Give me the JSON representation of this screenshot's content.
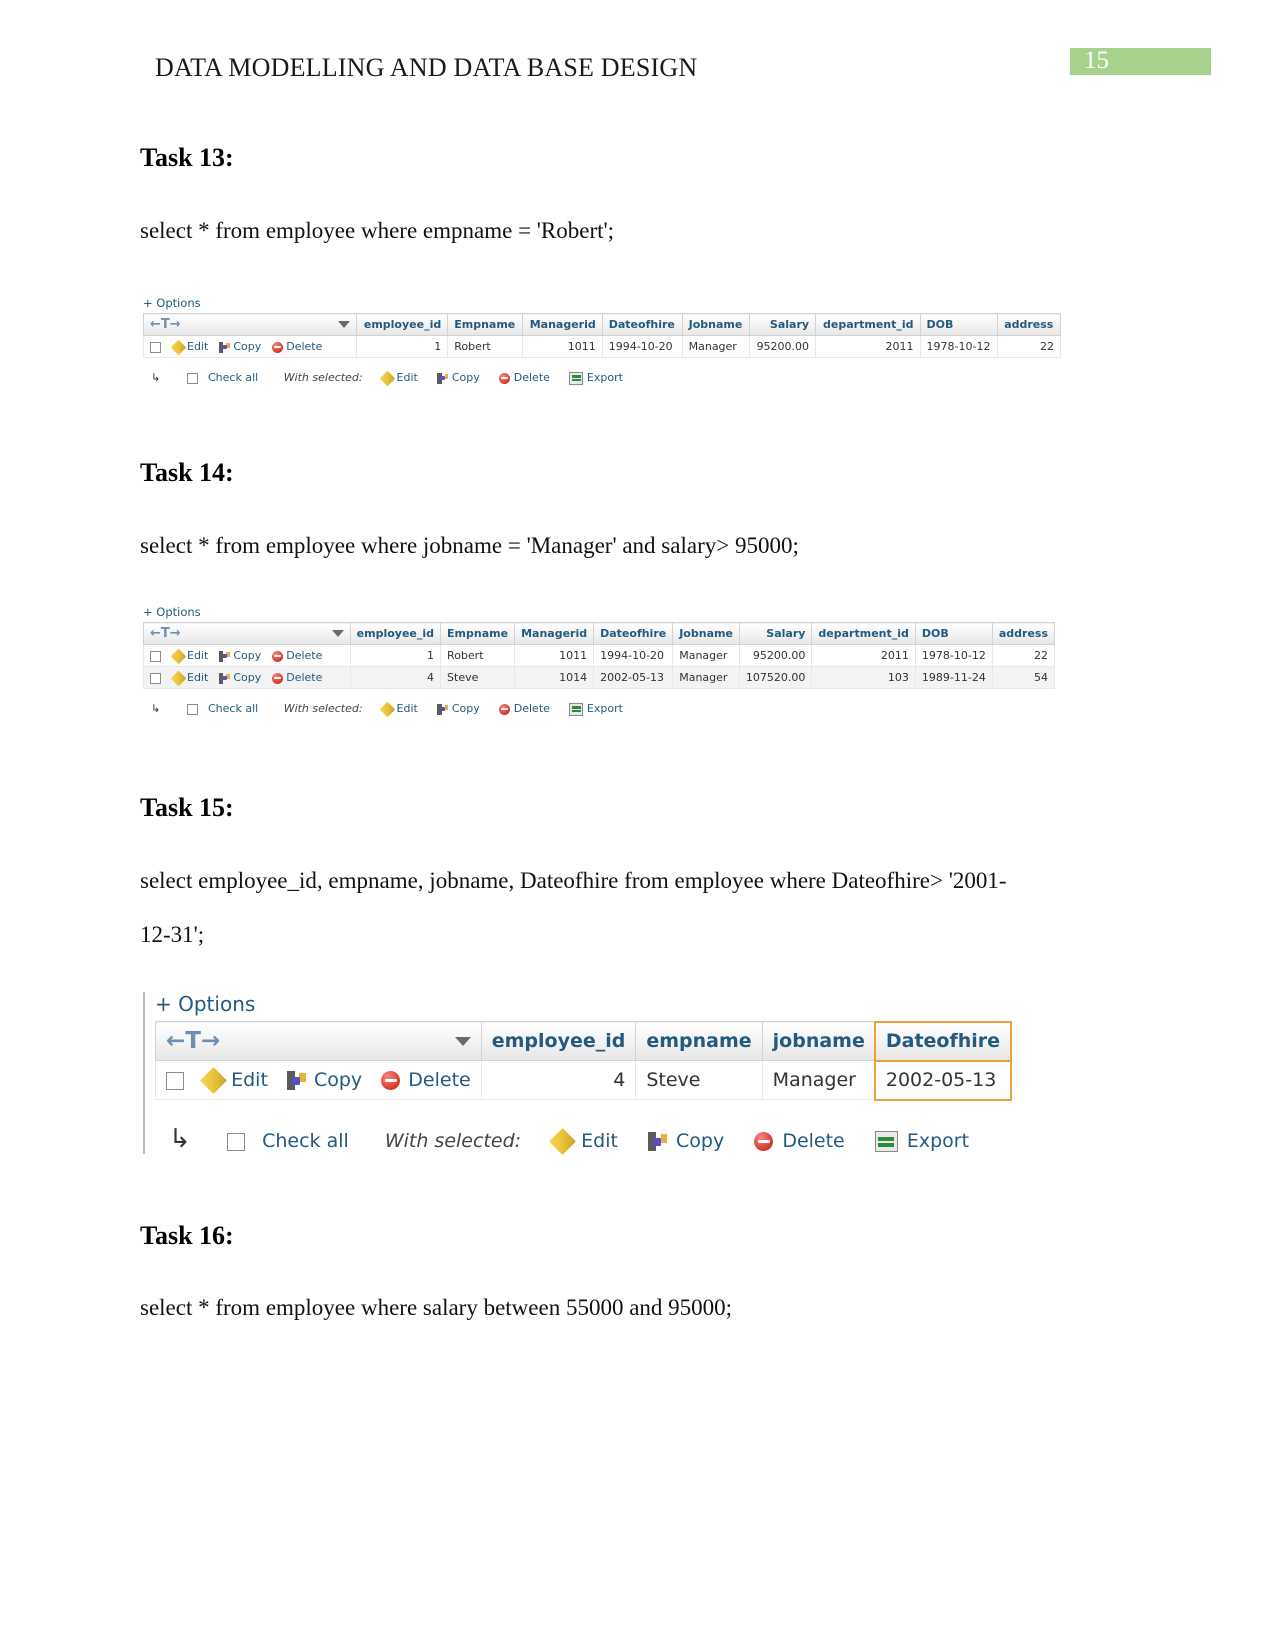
{
  "header": {
    "title": "DATA MODELLING AND DATA BASE DESIGN",
    "page_number": "15",
    "badge_color": "#a9d18e"
  },
  "tasks": [
    {
      "heading": "Task 13:",
      "query": "select * from employee where empname = 'Robert';"
    },
    {
      "heading": "Task 14:",
      "query": "select * from employee where jobname = 'Manager' and salary> 95000;"
    },
    {
      "heading": "Task 15:",
      "query_line1": "select employee_id, empname, jobname, Dateofhire from employee where Dateofhire> '2001-",
      "query_line2": "12-31';"
    },
    {
      "heading": "Task 16:",
      "query": "select * from employee where salary between 55000 and 95000;"
    }
  ],
  "common": {
    "options_label": "+ Options",
    "edit_label": "Edit",
    "copy_label": "Copy",
    "delete_label": "Delete",
    "export_label": "Export",
    "check_all_label": "Check all",
    "with_selected_label": "With selected:",
    "nav_arrows": "←T→",
    "icons": {
      "edit": "pencil-icon",
      "copy": "copy-icon",
      "delete": "delete-circle-icon",
      "export": "export-spreadsheet-icon",
      "sort": "caret-down-icon",
      "back": "arrow-up-left-icon"
    }
  },
  "result_tables": [
    {
      "id": "task13-result",
      "columns": [
        "employee_id",
        "Empname",
        "Managerid",
        "Dateofhire",
        "Jobname",
        "Salary",
        "department_id",
        "DOB",
        "address"
      ],
      "rows": [
        {
          "employee_id": "1",
          "Empname": "Robert",
          "Managerid": "1011",
          "Dateofhire": "1994-10-20",
          "Jobname": "Manager",
          "Salary": "95200.00",
          "department_id": "2011",
          "DOB": "1978-10-12",
          "address": "22"
        }
      ]
    },
    {
      "id": "task14-result",
      "columns": [
        "employee_id",
        "Empname",
        "Managerid",
        "Dateofhire",
        "Jobname",
        "Salary",
        "department_id",
        "DOB",
        "address"
      ],
      "rows": [
        {
          "employee_id": "1",
          "Empname": "Robert",
          "Managerid": "1011",
          "Dateofhire": "1994-10-20",
          "Jobname": "Manager",
          "Salary": "95200.00",
          "department_id": "2011",
          "DOB": "1978-10-12",
          "address": "22"
        },
        {
          "employee_id": "4",
          "Empname": "Steve",
          "Managerid": "1014",
          "Dateofhire": "2002-05-13",
          "Jobname": "Manager",
          "Salary": "107520.00",
          "department_id": "103",
          "DOB": "1989-11-24",
          "address": "54"
        }
      ]
    },
    {
      "id": "task15-result",
      "columns": [
        "employee_id",
        "empname",
        "jobname",
        "Dateofhire"
      ],
      "highlighted_column": "Dateofhire",
      "rows": [
        {
          "employee_id": "4",
          "empname": "Steve",
          "jobname": "Manager",
          "Dateofhire": "2002-05-13"
        }
      ]
    }
  ]
}
